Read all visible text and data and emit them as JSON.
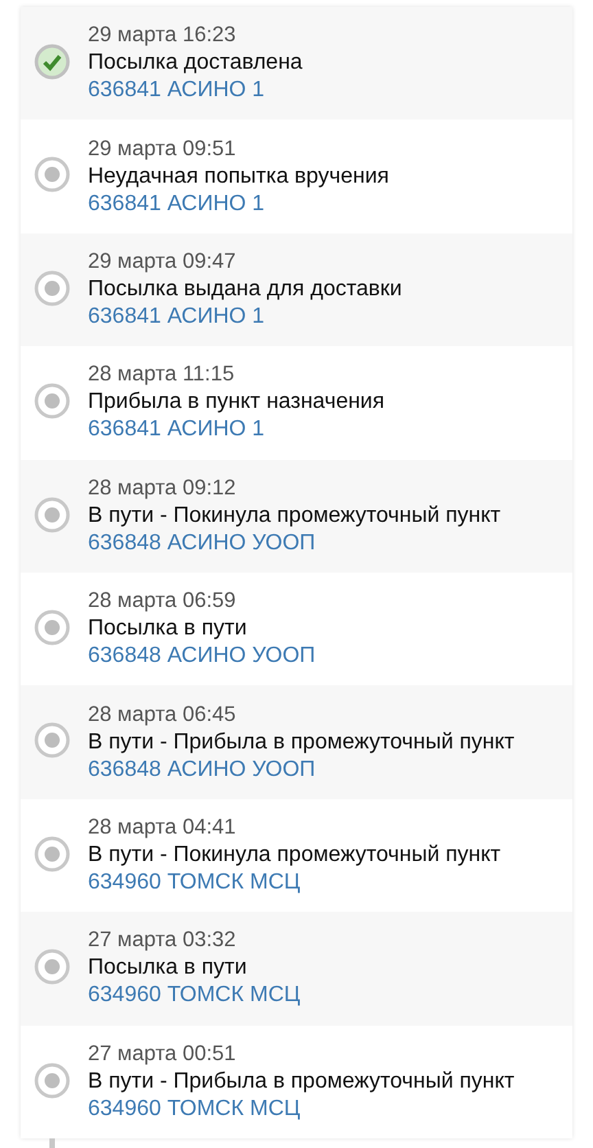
{
  "events": [
    {
      "time": "29 марта 16:23",
      "status": "Посылка доставлена",
      "place": "636841 АСИНО 1",
      "kind": "delivered"
    },
    {
      "time": "29 марта 09:51",
      "status": "Неудачная попытка вручения",
      "place": "636841 АСИНО 1",
      "kind": "transit"
    },
    {
      "time": "29 марта 09:47",
      "status": "Посылка выдана для доставки",
      "place": "636841 АСИНО 1",
      "kind": "transit"
    },
    {
      "time": "28 марта 11:15",
      "status": "Прибыла в пункт назначения",
      "place": "636841 АСИНО 1",
      "kind": "transit"
    },
    {
      "time": "28 марта 09:12",
      "status": "В пути - Покинула промежуточный пункт",
      "place": "636848 АСИНО УООП",
      "kind": "transit"
    },
    {
      "time": "28 марта 06:59",
      "status": "Посылка в пути",
      "place": "636848 АСИНО УООП",
      "kind": "transit"
    },
    {
      "time": "28 марта 06:45",
      "status": "В пути - Прибыла в промежуточный пункт",
      "place": "636848 АСИНО УООП",
      "kind": "transit"
    },
    {
      "time": "28 марта 04:41",
      "status": "В пути - Покинула промежуточный пункт",
      "place": "634960 ТОМСК МСЦ",
      "kind": "transit"
    },
    {
      "time": "27 марта 03:32",
      "status": "Посылка в пути",
      "place": "634960 ТОМСК МСЦ",
      "kind": "transit"
    },
    {
      "time": "27 марта 00:51",
      "status": "В пути - Прибыла в промежуточный пункт",
      "place": "634960 ТОМСК МСЦ",
      "kind": "transit"
    }
  ]
}
